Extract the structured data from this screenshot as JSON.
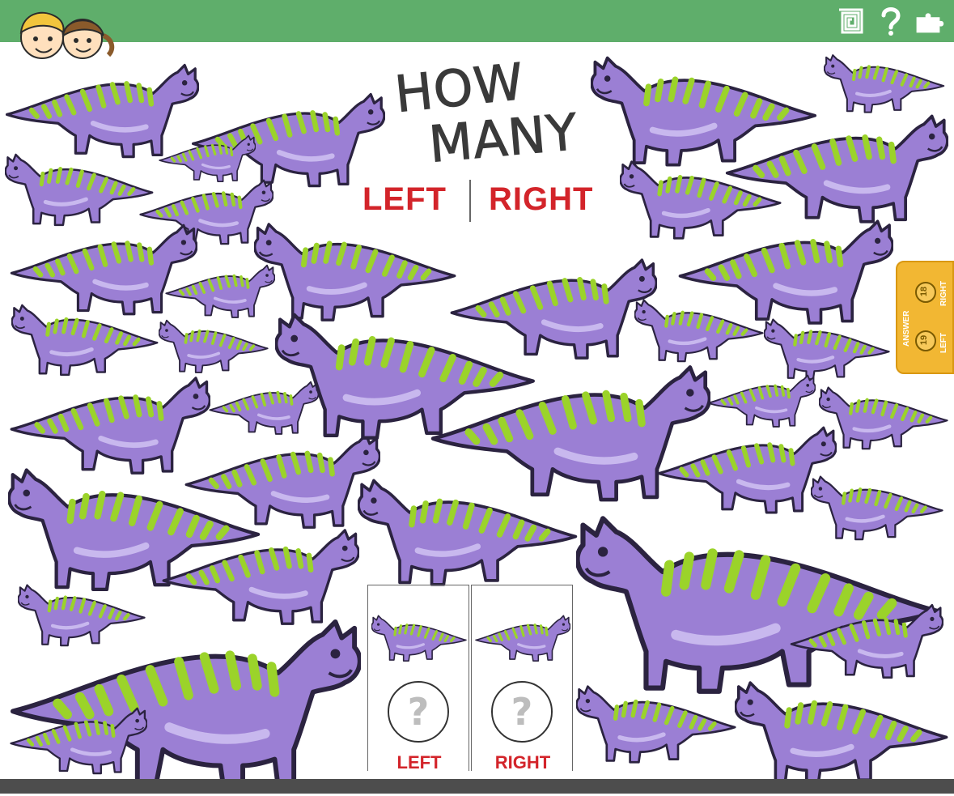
{
  "header": {
    "title_line1": "HOW",
    "title_line2": "MANY",
    "left_label": "LEFT",
    "right_label": "RIGHT",
    "icons": [
      "kids-logo-icon",
      "spiral-icon",
      "question-icon",
      "puzzle-icon"
    ]
  },
  "answer": {
    "heading": "ANSWER",
    "left_label": "LEFT",
    "left_count": "19",
    "right_label": "RIGHT",
    "right_count": "18"
  },
  "answer_box": {
    "left_label": "LEFT",
    "right_label": "RIGHT",
    "placeholder": "?"
  },
  "colors": {
    "top_bar": "#5fae6b",
    "dino_body": "#9b7fd4",
    "dino_stripes": "#9bd32a",
    "dino_outline": "#2b2340",
    "label_red": "#d3242a",
    "answer_tab": "#f2b733"
  },
  "dinosaurs": {
    "facing_left_count": 19,
    "facing_right_count": 18
  }
}
